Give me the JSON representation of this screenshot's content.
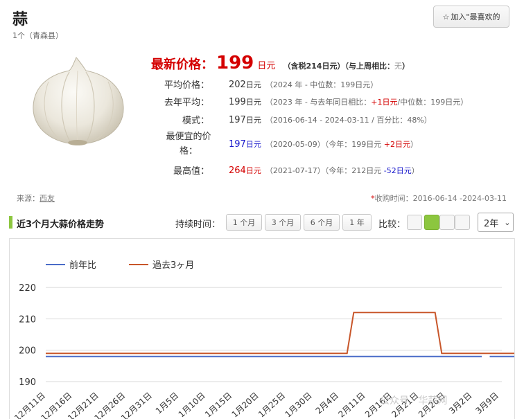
{
  "product": {
    "title": "蒜",
    "subtitle": "1个（青森县）"
  },
  "favorite": {
    "icon": "star-outline-icon",
    "label": "加入\"最喜欢的"
  },
  "price": {
    "latest_label": "最新价格：",
    "latest_value": "199",
    "unit": "日元",
    "tax_note": "（含税214日元）",
    "compare_label": "（与上周相比：",
    "compare_value": "无",
    "compare_close": "）"
  },
  "stats": [
    {
      "label": "平均价格：",
      "value": "202",
      "unit": "日元",
      "value_color": "normal",
      "note": "（2024 年 - 中位数：199日元）"
    },
    {
      "label": "去年平均：",
      "value": "199",
      "unit": "日元",
      "value_color": "normal",
      "note_pre": "（2023 年 - 与去年同日相比：",
      "note_hl": "+1日元",
      "note_post": "/中位数：199日元）"
    },
    {
      "label": "模式：",
      "value": "197",
      "unit": "日元",
      "value_color": "normal",
      "note": "（2016-06-14 - 2024-03-11 / 百分比：48%）"
    },
    {
      "label_line1": "最便宜的价",
      "label_line2": "格：",
      "value": "197",
      "unit": "日元",
      "value_color": "blue",
      "note_pre": "（2020-05-09）（今年：199日元 ",
      "note_hl": "+2日元",
      "note_post": "）"
    },
    {
      "label": "最高值：",
      "value": "264",
      "unit": "日元",
      "value_color": "red",
      "note_pre": "（2021-07-17）（今年：212日元 ",
      "note_hl": "-52日元",
      "note_post": "）"
    }
  ],
  "source": {
    "label": "来源：",
    "link": "西友"
  },
  "period": {
    "asterisk": "*",
    "text": "收购时间：2016-06-14 -2024-03-11"
  },
  "trend": {
    "title": "近3个月大蒜价格走势",
    "duration_label": "持续时间：",
    "durations": [
      "1 个月",
      "3 个月",
      "6 个月",
      "1 年"
    ],
    "compare_label": "比较：",
    "compare_options": [
      false,
      true,
      false,
      false
    ],
    "year_select": "2年"
  },
  "colors": {
    "accent_green": "#8cc63f",
    "price_red": "#d40000",
    "series_prev": "#4a6cc8",
    "series_3m": "#c8562a"
  },
  "chart_data": {
    "type": "line",
    "title": "",
    "xlabel": "",
    "ylabel": "",
    "ylim": [
      188,
      224
    ],
    "yticks": [
      190,
      200,
      210,
      220
    ],
    "grid": true,
    "legend": "top-left",
    "categories": [
      "12月11日",
      "12月16日",
      "12月21日",
      "12月26日",
      "12月31日",
      "1月5日",
      "1月10日",
      "1月15日",
      "1月20日",
      "1月25日",
      "1月30日",
      "2月4日",
      "2月11日",
      "2月16日",
      "2月21日",
      "2月26日",
      "3月2日",
      "3月9日"
    ],
    "series": [
      {
        "name": "前年比",
        "color": "#4a6cc8",
        "points": [
          [
            0,
            198
          ],
          [
            16.35,
            198
          ],
          null,
          [
            16.65,
            198
          ],
          [
            18,
            198
          ]
        ]
      },
      {
        "name": "過去3ヶ月",
        "color": "#c8562a",
        "points": [
          [
            0,
            199
          ],
          [
            11.3,
            199
          ],
          [
            11.55,
            212
          ],
          [
            14.6,
            212
          ],
          [
            14.85,
            199
          ],
          [
            18,
            199
          ]
        ]
      }
    ]
  },
  "watermark": "公众号 · 华蒜网"
}
